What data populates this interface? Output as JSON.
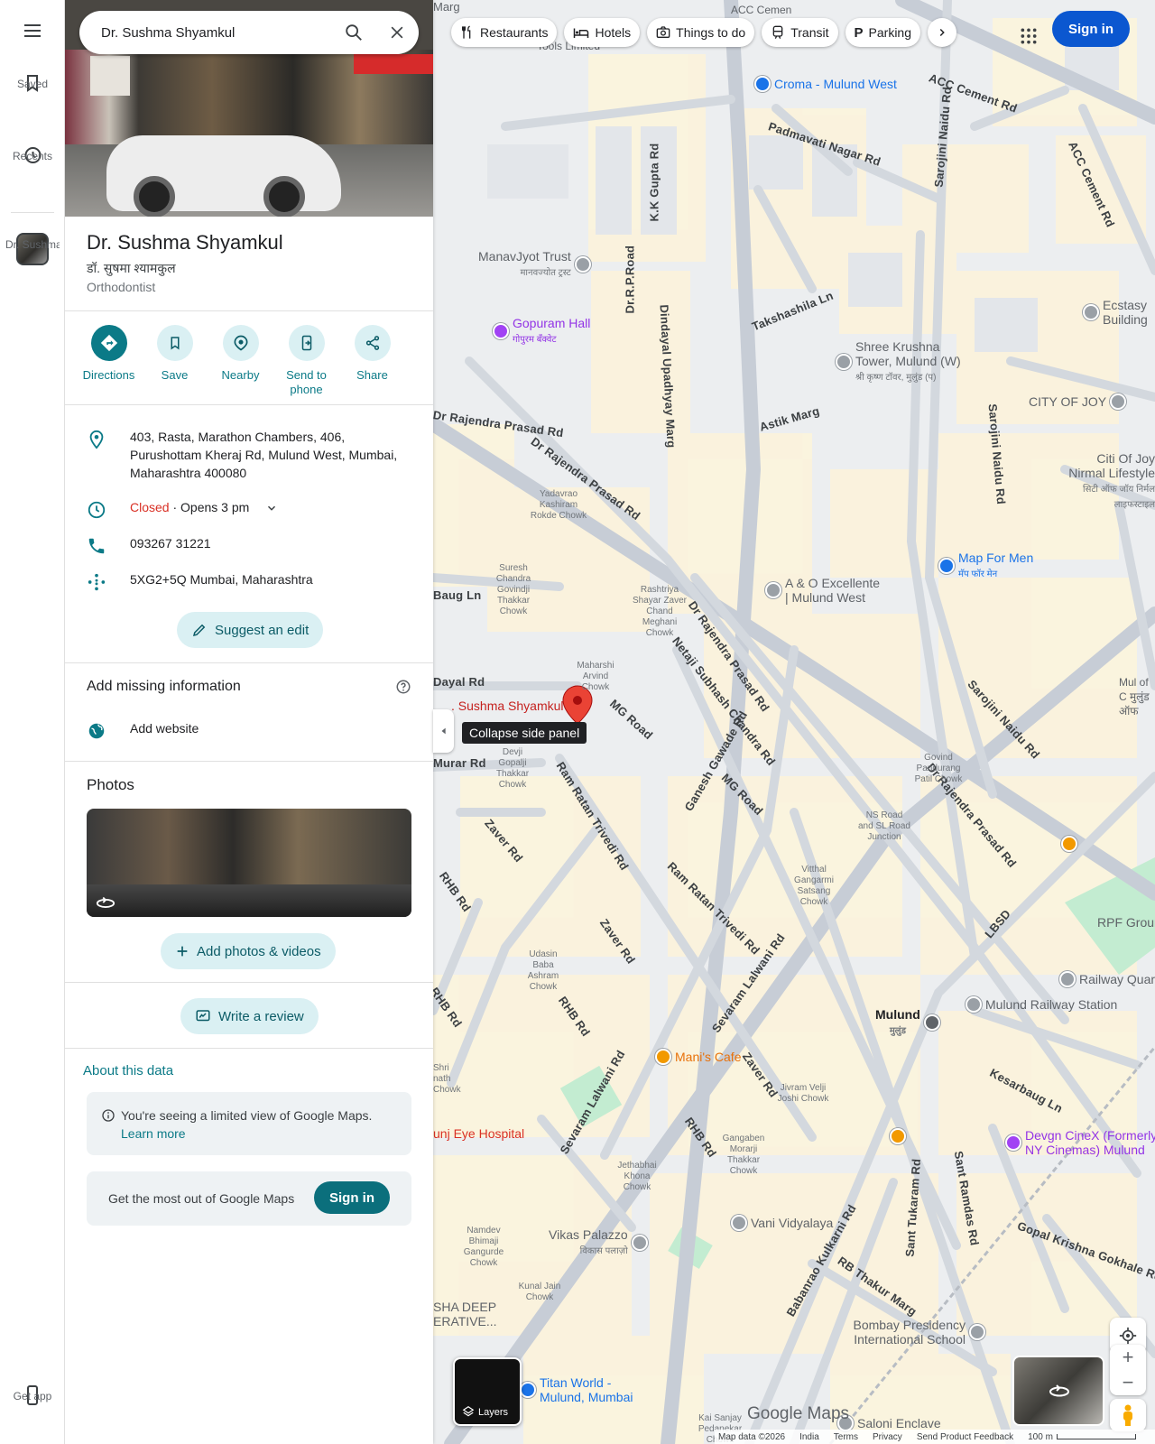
{
  "rail": {
    "menu_icon": "menu-icon",
    "saved": "Saved",
    "recents": "Recents",
    "recent_place": "Dr. Sushma...",
    "get_app": "Get app"
  },
  "search": {
    "value": "Dr. Sushma Shyamkul"
  },
  "place": {
    "title": "Dr. Sushma Shyamkul",
    "subtitle": "डॉ. सुषमा श्यामकुल",
    "category": "Orthodontist",
    "actions": [
      "Directions",
      "Save",
      "Nearby",
      "Send to phone",
      "Share"
    ],
    "address_lines": [
      "403, Rasta, Marathon Chambers, 406,",
      "Purushottam Kheraj Rd, Mulund West, Mumbai,",
      "Maharashtra 400080"
    ],
    "hours_status": "Closed",
    "hours_next": " · Opens 3 pm",
    "phone": "093267 31221",
    "plus_code": "5XG2+5Q Mumbai, Maharashtra",
    "suggest_edit": "Suggest an edit",
    "missing_heading": "Add missing information",
    "add_website": "Add website",
    "photos_heading": "Photos",
    "add_photos": "Add photos & videos",
    "write_review": "Write a review",
    "about_data": "About this data",
    "notice": "You're seeing a limited view of Google Maps.",
    "learn_more": "Learn more",
    "get_most": "Get the most out of Google Maps",
    "sign_in": "Sign in"
  },
  "map": {
    "chips": [
      "Restaurants",
      "Hotels",
      "Things to do",
      "Transit",
      "Parking"
    ],
    "sign_in": "Sign in",
    "collapse_tooltip": "Collapse side panel",
    "marker_label": ". Sushma Shyamkul",
    "layers": "Layers",
    "google_maps": "Google Maps",
    "footer": [
      "Map data ©2026",
      "India",
      "Terms",
      "Privacy",
      "Send Product Feedback",
      "100 m"
    ],
    "roads": [
      "ACC Cement Rd",
      "Padmavati Nagar Rd",
      "K.K Gupta Rd",
      "Dr.R.P.Road",
      "Dindayal Upadhyay Marg",
      "Takshashila Ln",
      "Sarojini Naidu Rd",
      "Astik Marg",
      "Dr Rajendra Prasad Rd",
      "Baug Ln",
      "Dayal Rd",
      "MG Road",
      "Netaji Subhash Chandra Rd",
      "Ganesh Gawade Rd",
      "Murar Rd",
      "Ram Ratan Trivedi Rd",
      "Zaver Rd",
      "RHB Rd",
      "Sevaram Lalwani Rd",
      "Kesarbaug Ln",
      "Sant Ramdas Rd",
      "Gopal Krishna Gokhale Rd",
      "Babanrao Kulkarni Rd",
      "RB Thakur Marg",
      "Sant Tukaram Rd",
      "LBSD"
    ],
    "places": [
      "Croma - Mulund West",
      "ManavJyot Trust",
      "मानवज्योत ट्रस्ट",
      "Gopuram Hall",
      "गोपुरम बँक्वेट",
      "Shree Krushna Tower, Mulund (W)",
      "श्री कृष्ण टॉवर, मुलुंड (प)",
      "CITY OF JOY",
      "Ecstasy Building",
      "Citi Of Joy Nirmal Lifestyle",
      "सिटी ऑफ जॉय निर्मल लाइफस्टाइल",
      "Map For Men",
      "मॅप फॉर मेन",
      "A & O Excellente | Mulund West",
      "Mani's Cafe",
      "Mulund Railway Station",
      "Mulund",
      "मुलुंड",
      "RPF Ground",
      "Railway Quarters",
      "Devgn CineX (Formerly NY Cinemas) Mulund",
      "Vani Vidyalaya",
      "Vikas Palazzo",
      "विकास पलाज़ो",
      "Bombay Presidency International School",
      "Titan World - Mulund, Mumbai",
      "Saloni Enclave",
      "unj Eye Hospital",
      "SHA DEEP ERATIVE...",
      "Mul of C मुलुंड ऑफ"
    ],
    "chowks": [
      "Yadavrao Kashiram Rokde Chowk",
      "Suresh Chandra Govindji Thakkar Chowk",
      "Rashtriya Shayar Zaver Chand Meghani Chowk",
      "Maharshi Arvind Chowk",
      "Devji Gopalji Thakkar Chowk",
      "Govind Pandurang Patil Chowk",
      "NS Road and SL Road Junction",
      "Vitthal Gangarmi Satsang Chowk",
      "Udasin Baba Ashram Chowk",
      "Jivram Velji Joshi Chowk",
      "Gangaben Morarji Thakkar Chowk",
      "Jethabhai Khona Chowk",
      "Namdev Bhimaji Gangurde Chowk",
      "Kunal Jain Chowk",
      "Shri nath Chowk",
      "Kai Sanjay Pedanekar Chowk",
      "Marg",
      "Tools Limited",
      "ACC Cemen"
    ]
  }
}
